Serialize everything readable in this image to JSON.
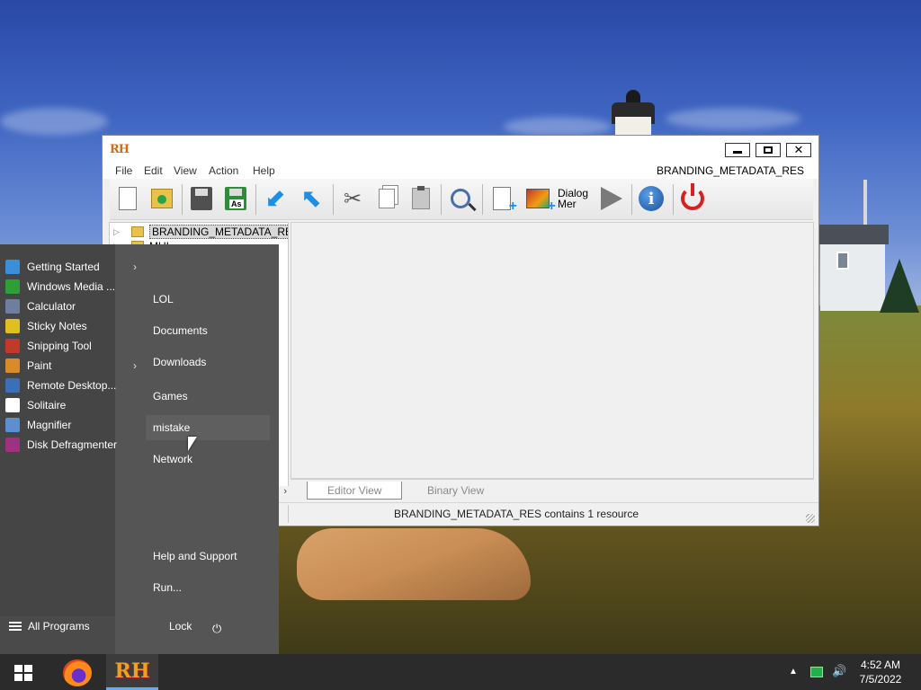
{
  "window": {
    "app_icon_text": "RH",
    "minimize_glyph": "",
    "close_glyph": "✕",
    "resource_name": "BRANDING_METADATA_RES"
  },
  "menubar": {
    "items": [
      "File",
      "Edit",
      "View",
      "Action",
      "Help"
    ]
  },
  "toolbar": {
    "dialog_menu_label_1": "Dialog",
    "dialog_menu_label_2": "Mer",
    "info_glyph": "i",
    "icons": [
      "new-file-icon",
      "open-folder-icon",
      "save-icon",
      "save-as-icon",
      "import-arrow-icon",
      "export-arrow-icon",
      "cut-icon",
      "copy-icon",
      "paste-icon",
      "find-icon",
      "add-blank-resource-icon",
      "add-image-resource-icon",
      "dialog-merge-icon",
      "run-script-icon",
      "info-icon",
      "exit-icon"
    ]
  },
  "tree": {
    "items": [
      {
        "label": "BRANDING_METADATA_RE",
        "selected": true
      },
      {
        "label": "MUI",
        "selected": false
      }
    ]
  },
  "view_tabs": {
    "editor": "Editor View",
    "binary": "Binary View"
  },
  "status": {
    "text": "BRANDING_METADATA_RES contains 1 resource"
  },
  "start_menu": {
    "programs": [
      {
        "label": "Getting Started",
        "has_submenu": true,
        "icon_color": "#3a8fd8"
      },
      {
        "label": "Windows Media ...",
        "has_submenu": false,
        "icon_color": "#2e9e3a"
      },
      {
        "label": "Calculator",
        "has_submenu": false,
        "icon_color": "#6f7ea0"
      },
      {
        "label": "Sticky Notes",
        "has_submenu": false,
        "icon_color": "#e0c020"
      },
      {
        "label": "Snipping Tool",
        "has_submenu": false,
        "icon_color": "#c0392b"
      },
      {
        "label": "Paint",
        "has_submenu": true,
        "icon_color": "#d98b2a"
      },
      {
        "label": "Remote Desktop...",
        "has_submenu": false,
        "icon_color": "#3b6fb6"
      },
      {
        "label": "Solitaire",
        "has_submenu": false,
        "icon_color": "#ffffff"
      },
      {
        "label": "Magnifier",
        "has_submenu": false,
        "icon_color": "#5b8fcf"
      },
      {
        "label": "Disk Defragmenter",
        "has_submenu": false,
        "icon_color": "#a03080"
      }
    ],
    "places": [
      "LOL",
      "Documents",
      "Downloads",
      "Games",
      "mistake",
      "Network",
      "Help and Support",
      "Run..."
    ],
    "all_programs": "All Programs",
    "lock": "Lock",
    "shutdown_glyph": "⏻",
    "submenu_glyph": "›"
  },
  "taskbar": {
    "time": "4:52 AM",
    "date": "7/5/2022",
    "rh_label": "RH",
    "tray_up_glyph": "▲",
    "volume_glyph": "🔊"
  },
  "colors": {
    "accent": "#5ab0ff",
    "start_menu_bg": "#4a4a4a",
    "taskbar_bg": "#2b2b2b"
  }
}
